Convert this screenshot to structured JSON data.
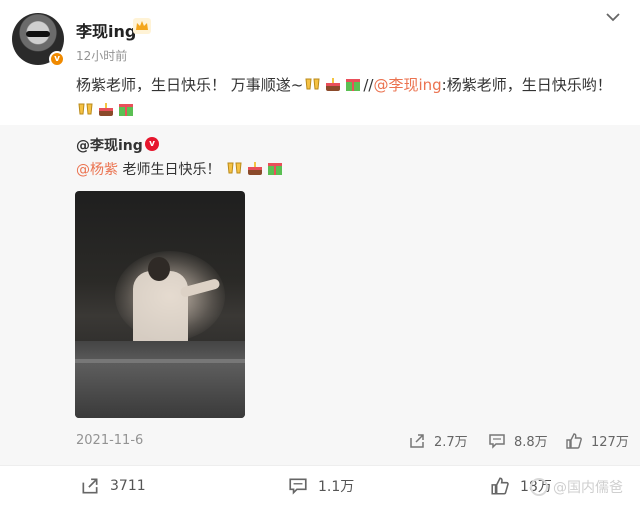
{
  "post": {
    "username": "李现ing",
    "time": "12小时前",
    "text_line1_a": "杨紫老师，生日快乐！ 万事顺遂~",
    "text_line1_sep": "//",
    "text_line1_mention": "@李现ing",
    "text_line1_b": ":杨紫老师，生日快乐哟！",
    "icons": {
      "avatar": "avatar-photo",
      "verified": "verified-badge",
      "crown": "crown-icon",
      "more": "chevron-down-icon"
    }
  },
  "repost": {
    "author": "@李现ing",
    "mention": "@杨紫",
    "text": " 老师生日快乐！",
    "date": "2021-11-6",
    "shares": "2.7万",
    "comments": "8.8万",
    "likes": "127万"
  },
  "actions": {
    "shares": "3711",
    "comments": "1.1万",
    "likes": "18万"
  },
  "watermark": "@国内儒爸",
  "colors": {
    "mention": "#eb7350",
    "repost_bg": "#f7f7f7",
    "badge": "#f08a00"
  }
}
